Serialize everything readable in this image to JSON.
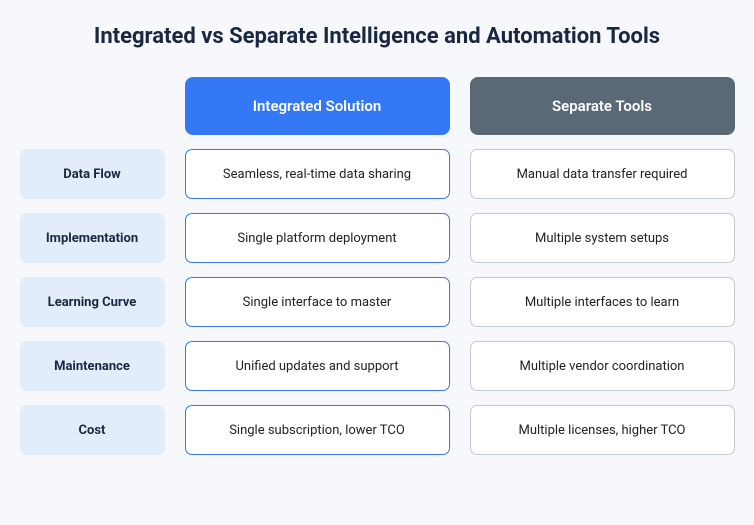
{
  "title": "Integrated vs Separate Intelligence and Automation Tools",
  "columns": {
    "integrated": "Integrated Solution",
    "separate": "Separate Tools"
  },
  "rows": [
    {
      "label": "Data Flow",
      "integrated": "Seamless, real-time data sharing",
      "separate": "Manual data transfer required"
    },
    {
      "label": "Implementation",
      "integrated": "Single platform deployment",
      "separate": "Multiple system setups"
    },
    {
      "label": "Learning Curve",
      "integrated": "Single interface to master",
      "separate": "Multiple interfaces to learn"
    },
    {
      "label": "Maintenance",
      "integrated": "Unified updates and support",
      "separate": "Multiple vendor coordination"
    },
    {
      "label": "Cost",
      "integrated": "Single subscription, lower TCO",
      "separate": "Multiple licenses, higher TCO"
    }
  ]
}
